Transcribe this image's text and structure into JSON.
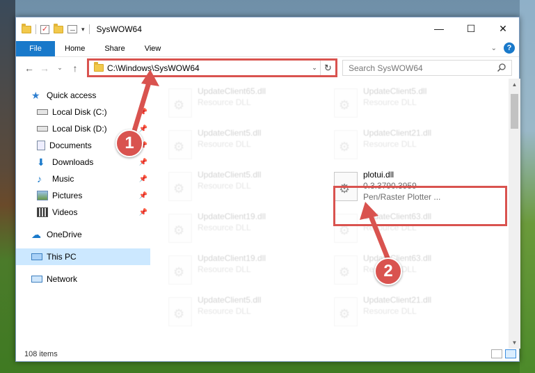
{
  "window": {
    "title": "SysWOW64",
    "controls": {
      "minimize": "—",
      "maximize": "☐",
      "close": "✕"
    }
  },
  "ribbon": {
    "tabs": [
      "File",
      "Home",
      "Share",
      "View"
    ],
    "collapse": "⌄",
    "help": "?"
  },
  "nav": {
    "back": "←",
    "forward": "→",
    "recent": "⌄",
    "up": "↑",
    "address": "C:\\Windows\\SysWOW64",
    "address_dropdown": "⌄",
    "refresh": "↻",
    "search_placeholder": "Search SysWOW64"
  },
  "sidebar": {
    "items": [
      {
        "label": "Quick access",
        "icon": "star-icon",
        "pinned": false
      },
      {
        "label": "Local Disk (C:)",
        "icon": "drive-icon",
        "pinned": true
      },
      {
        "label": "Local Disk (D:)",
        "icon": "drive-icon",
        "pinned": true
      },
      {
        "label": "Documents",
        "icon": "documents-icon",
        "pinned": true
      },
      {
        "label": "Downloads",
        "icon": "download-icon",
        "pinned": true
      },
      {
        "label": "Music",
        "icon": "music-icon",
        "pinned": true
      },
      {
        "label": "Pictures",
        "icon": "pictures-icon",
        "pinned": true
      },
      {
        "label": "Videos",
        "icon": "videos-icon",
        "pinned": true
      },
      {
        "label": "OneDrive",
        "icon": "cloud-icon",
        "pinned": false
      },
      {
        "label": "This PC",
        "icon": "computer-icon",
        "pinned": false
      },
      {
        "label": "Network",
        "icon": "network-icon",
        "pinned": false
      }
    ]
  },
  "files": [
    {
      "name": "UpdateClient65.dll",
      "meta": "Resource DLL"
    },
    {
      "name": "UpdateClient5.dll",
      "meta": "Resource DLL"
    },
    {
      "name": "UpdateClient5.dll",
      "meta": "Resource DLL"
    },
    {
      "name": "UpdateClient21.dll",
      "meta": "Resource DLL"
    },
    {
      "name": "UpdateClient5.dll",
      "meta": "Resource DLL"
    },
    {
      "name": "plotui.dll",
      "meta": "0.3.3790.3959",
      "meta2": "Pen/Raster Plotter ..."
    },
    {
      "name": "UpdateClient19.dll",
      "meta": "Resource DLL"
    },
    {
      "name": "UpdateClient63.dll",
      "meta": "Resource DLL"
    },
    {
      "name": "UpdateClient19.dll",
      "meta": "Resource DLL"
    },
    {
      "name": "UpdateClient63.dll",
      "meta": "Resource DLL"
    },
    {
      "name": "UpdateClient5.dll",
      "meta": "Resource DLL"
    },
    {
      "name": "UpdateClient21.dll",
      "meta": "Resource DLL"
    }
  ],
  "status": {
    "count": "108 items"
  },
  "callouts": [
    "1",
    "2"
  ],
  "colors": {
    "accent": "#1979ca",
    "highlight": "#d9534f",
    "selected": "#cce8ff"
  }
}
